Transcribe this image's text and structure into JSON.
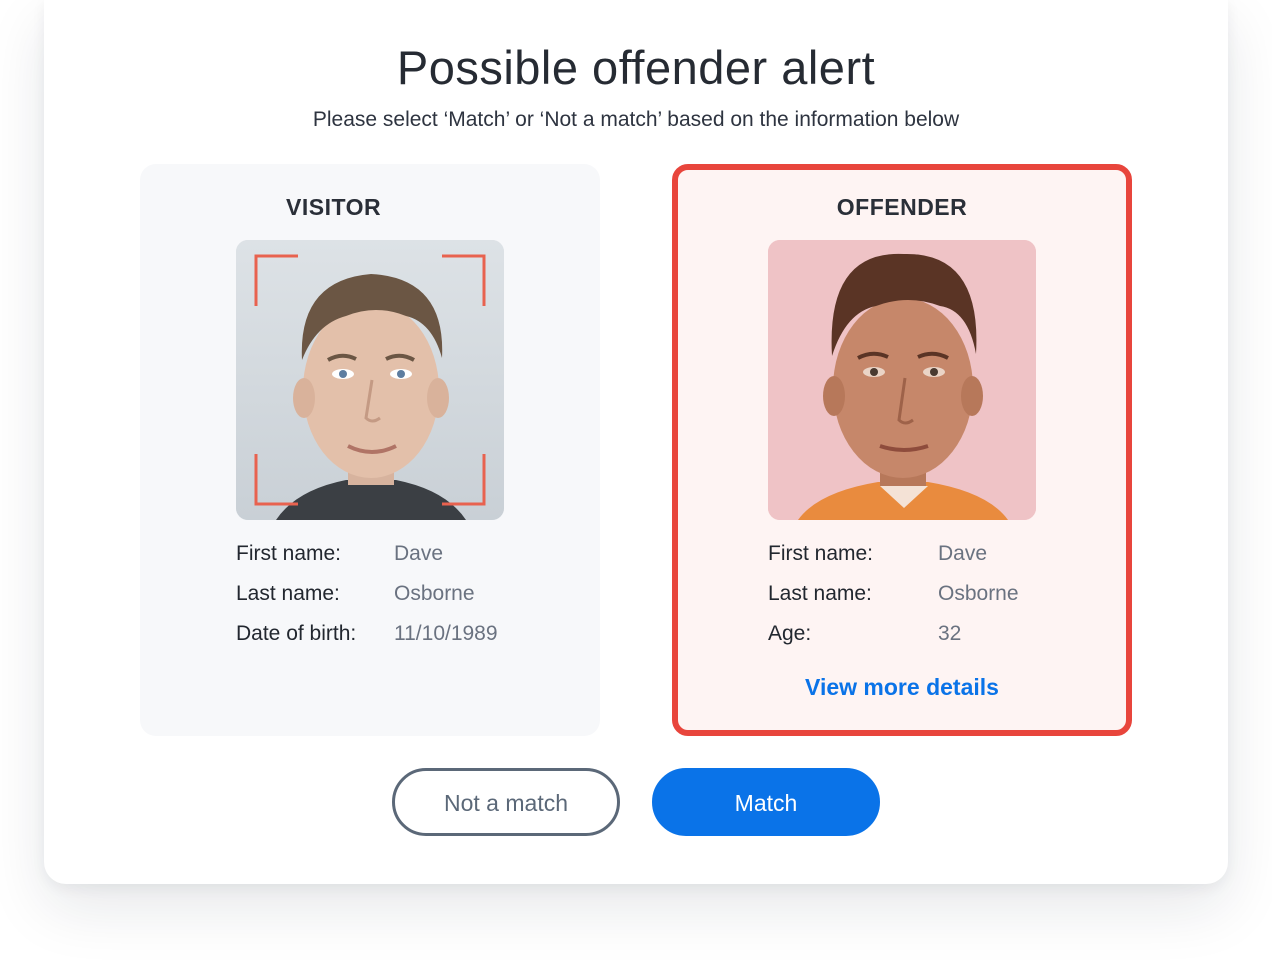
{
  "dialog": {
    "title": "Possible offender alert",
    "subtitle": "Please select ‘Match’ or ‘Not a match’ based on the information below"
  },
  "visitor": {
    "heading": "VISITOR",
    "photo_icon": "face-scan-frame-icon",
    "fields": [
      {
        "label": "First name:",
        "value": "Dave"
      },
      {
        "label": "Last name:",
        "value": "Osborne"
      },
      {
        "label": "Date of birth:",
        "value": "11/10/1989"
      }
    ]
  },
  "offender": {
    "heading": "OFFENDER",
    "fields": [
      {
        "label": "First name:",
        "value": "Dave"
      },
      {
        "label": "Last name:",
        "value": "Osborne"
      },
      {
        "label": "Age:",
        "value": "32"
      }
    ],
    "link_label": "View more details"
  },
  "actions": {
    "not_match_label": "Not a match",
    "match_label": "Match"
  },
  "colors": {
    "accent": "#0a73e8",
    "alert": "#e8453c",
    "scan_frame": "#e8624f"
  }
}
